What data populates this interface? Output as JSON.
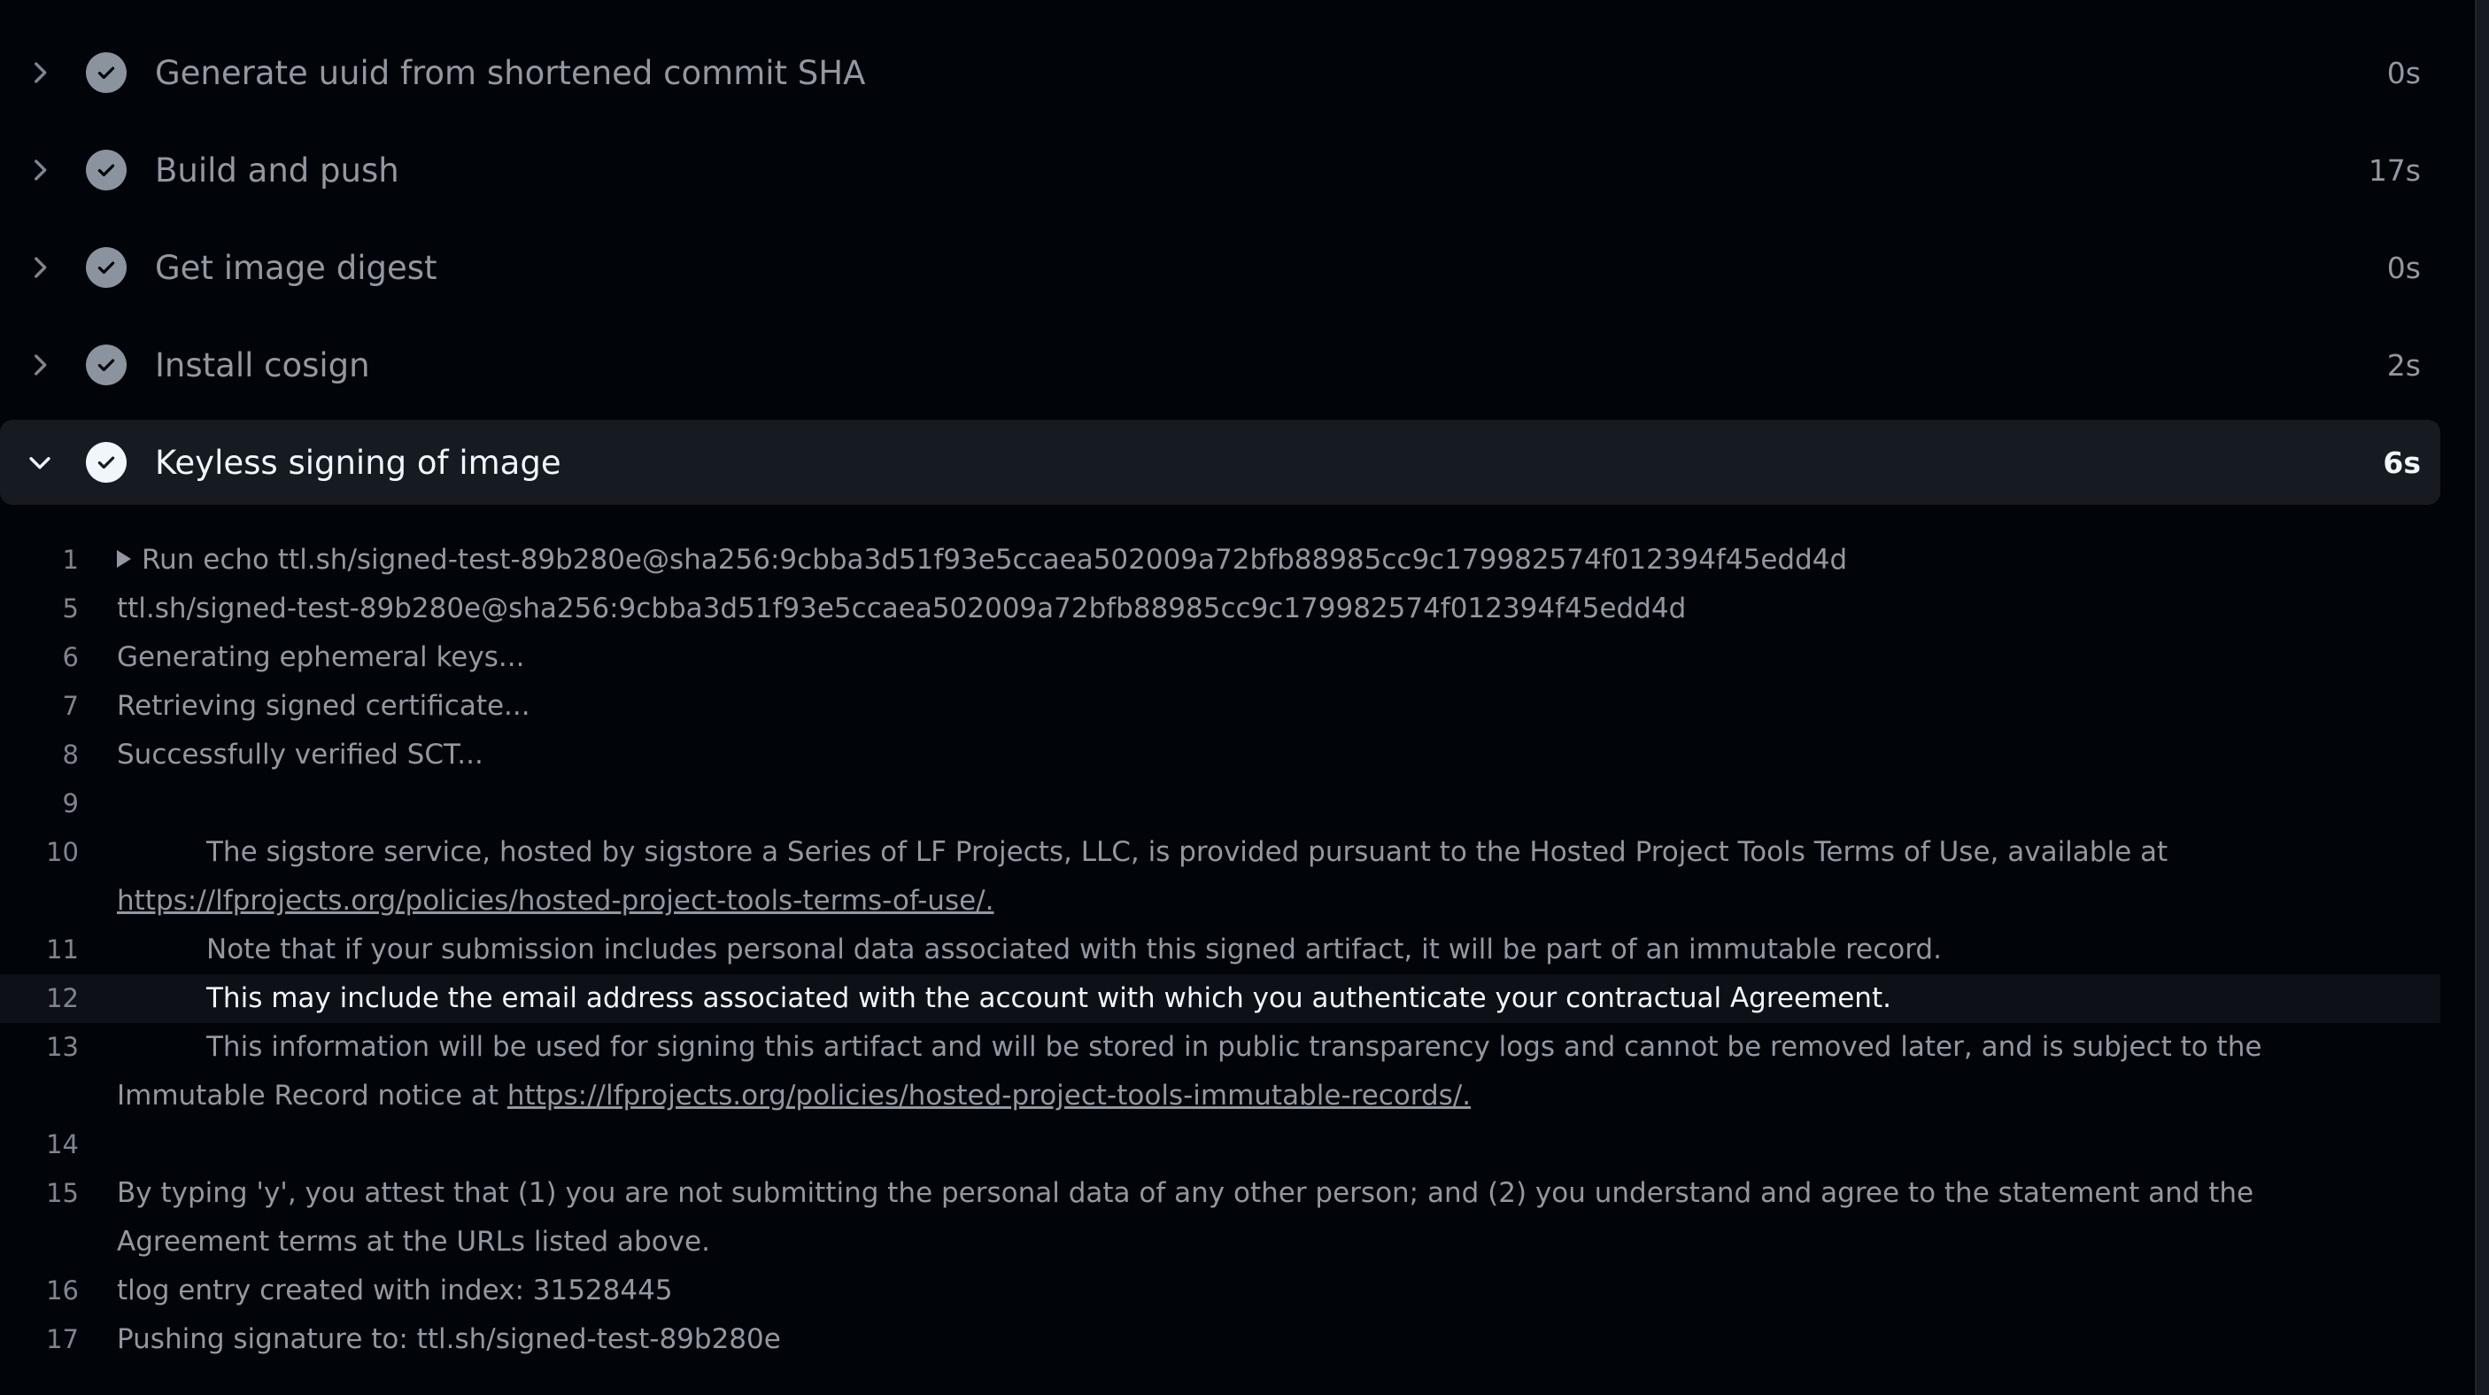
{
  "steps": [
    {
      "title": "Generate uuid from shortened commit SHA",
      "duration": "0s",
      "status": "success",
      "expanded": false
    },
    {
      "title": "Build and push",
      "duration": "17s",
      "status": "success",
      "expanded": false
    },
    {
      "title": "Get image digest",
      "duration": "0s",
      "status": "success",
      "expanded": false
    },
    {
      "title": "Install cosign",
      "duration": "2s",
      "status": "success",
      "expanded": false
    },
    {
      "title": "Keyless signing of image",
      "duration": "6s",
      "status": "success",
      "expanded": true
    }
  ],
  "icons": {
    "collapsed": "chevron-right-icon",
    "expanded": "chevron-down-icon",
    "status": "check-circle-icon",
    "run_group": "triangle-right-icon"
  },
  "log": [
    {
      "num": "1",
      "text": "Run echo ttl.sh/signed-test-89b280e@sha256:9cbba3d51f93e5ccaea502009a72bfb88985cc9c179982574f012394f45edd4d",
      "collapsible": true
    },
    {
      "num": "5",
      "text": "ttl.sh/signed-test-89b280e@sha256:9cbba3d51f93e5ccaea502009a72bfb88985cc9c179982574f012394f45edd4d"
    },
    {
      "num": "6",
      "text": "Generating ephemeral keys..."
    },
    {
      "num": "7",
      "text": "Retrieving signed certificate..."
    },
    {
      "num": "8",
      "text": "Successfully verified SCT..."
    },
    {
      "num": "9",
      "text": ""
    },
    {
      "num": "10",
      "text": "The sigstore service, hosted by sigstore a Series of LF Projects, LLC, is provided pursuant to the Hosted Project Tools Terms of Use, available at ",
      "indent": true,
      "link": "https://lfprojects.org/policies/hosted-project-tools-terms-of-use/."
    },
    {
      "num": "11",
      "text": "Note that if your submission includes personal data associated with this signed artifact, it will be part of an immutable record.",
      "indent": true
    },
    {
      "num": "12",
      "text": "This may include the email address associated with the account with which you authenticate your contractual Agreement.",
      "indent": true,
      "highlight": true
    },
    {
      "num": "13",
      "text": "This information will be used for signing this artifact and will be stored in public transparency logs and cannot be removed later, and is subject to the Immutable Record notice at ",
      "indent": true,
      "link": "https://lfprojects.org/policies/hosted-project-tools-immutable-records/."
    },
    {
      "num": "14",
      "text": ""
    },
    {
      "num": "15",
      "text": "By typing 'y', you attest that (1) you are not submitting the personal data of any other person; and (2) you understand and agree to the statement and the Agreement terms at the URLs listed above."
    },
    {
      "num": "16",
      "text": "tlog entry created with index: 31528445"
    },
    {
      "num": "17",
      "text": "Pushing signature to: ttl.sh/signed-test-89b280e"
    }
  ]
}
